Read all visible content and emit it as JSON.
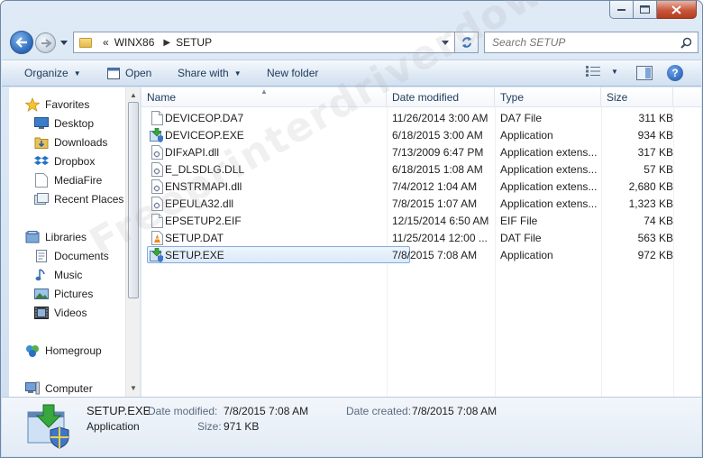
{
  "window": {
    "controls": {
      "minimize": "minimize",
      "maximize": "maximize",
      "close": "close"
    }
  },
  "address": {
    "overflow": "«",
    "crumbs": [
      "WINX86",
      "SETUP"
    ]
  },
  "search": {
    "placeholder": "Search SETUP"
  },
  "toolbar": {
    "organize": "Organize",
    "open": "Open",
    "share_with": "Share with",
    "new_folder": "New folder"
  },
  "nav": {
    "favorites": "Favorites",
    "favorites_items": [
      "Desktop",
      "Downloads",
      "Dropbox",
      "MediaFire",
      "Recent Places"
    ],
    "libraries": "Libraries",
    "libraries_items": [
      "Documents",
      "Music",
      "Pictures",
      "Videos"
    ],
    "homegroup": "Homegroup",
    "computer": "Computer"
  },
  "columns": {
    "name": "Name",
    "date": "Date modified",
    "type": "Type",
    "size": "Size"
  },
  "files": [
    {
      "name": "DEVICEOP.DA7",
      "date": "11/26/2014 3:00 AM",
      "type": "DA7 File",
      "size": "311 KB",
      "icon": "file-icon"
    },
    {
      "name": "DEVICEOP.EXE",
      "date": "6/18/2015 3:00 AM",
      "type": "Application",
      "size": "934 KB",
      "icon": "installer-icon"
    },
    {
      "name": "DIFxAPI.dll",
      "date": "7/13/2009 6:47 PM",
      "type": "Application extens...",
      "size": "317 KB",
      "icon": "dll-icon"
    },
    {
      "name": "E_DLSDLG.DLL",
      "date": "6/18/2015 1:08 AM",
      "type": "Application extens...",
      "size": "57 KB",
      "icon": "dll-icon"
    },
    {
      "name": "ENSTRMAPI.dll",
      "date": "7/4/2012 1:04 AM",
      "type": "Application extens...",
      "size": "2,680 KB",
      "icon": "dll-icon"
    },
    {
      "name": "EPEULA32.dll",
      "date": "7/8/2015 1:07 AM",
      "type": "Application extens...",
      "size": "1,323 KB",
      "icon": "dll-icon"
    },
    {
      "name": "EPSETUP2.EIF",
      "date": "12/15/2014 6:50 AM",
      "type": "EIF File",
      "size": "74 KB",
      "icon": "file-icon"
    },
    {
      "name": "SETUP.DAT",
      "date": "11/25/2014 12:00 ...",
      "type": "DAT File",
      "size": "563 KB",
      "icon": "vlc-icon"
    },
    {
      "name": "SETUP.EXE",
      "date": "7/8/2015 7:08 AM",
      "type": "Application",
      "size": "972 KB",
      "icon": "installer-icon",
      "selected": true
    }
  ],
  "watermark": "Freeprinterdriverdownload.org",
  "details": {
    "filename": "SETUP.EXE",
    "filetype": "Application",
    "date_modified_label": "Date modified:",
    "date_modified": "7/8/2015 7:08 AM",
    "size_label": "Size:",
    "size": "971 KB",
    "date_created_label": "Date created:",
    "date_created": "7/8/2015 7:08 AM"
  }
}
